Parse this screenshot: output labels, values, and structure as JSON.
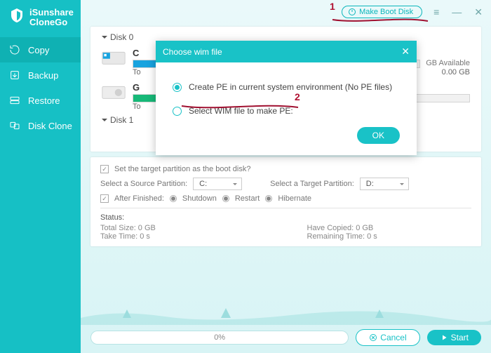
{
  "app": {
    "brand_line1": "iSunshare",
    "brand_line2": "CloneGo"
  },
  "sidebar": {
    "items": [
      {
        "label": "Copy"
      },
      {
        "label": "Backup"
      },
      {
        "label": "Restore"
      },
      {
        "label": "Disk Clone"
      }
    ]
  },
  "topbar": {
    "boot_label": "Make Boot Disk"
  },
  "disks": {
    "d0_head": "Disk 0",
    "d1_head": "Disk 1",
    "c_title": "C",
    "c_avail": "GB Available",
    "c_total_line": "To",
    "c_total_right": "0.00 GB",
    "g_title": "G",
    "g_total_line": "To"
  },
  "lower": {
    "set_target": "Set the target partition as the boot disk?",
    "src_label": "Select a Source Partition:",
    "src_val": "C:",
    "tgt_label": "Select a Target Partition:",
    "tgt_val": "D:",
    "after_label": "After Finished:",
    "r1": "Shutdown",
    "r2": "Restart",
    "r3": "Hibernate",
    "status_label": "Status:",
    "total_size": "Total Size: 0 GB",
    "have_copied": "Have Copied: 0 GB",
    "take_time": "Take Time: 0 s",
    "remaining": "Remaining Time: 0 s"
  },
  "bottom": {
    "progress": "0%",
    "cancel": "Cancel",
    "start": "Start"
  },
  "modal": {
    "title": "Choose wim file",
    "opt1": "Create PE in current system environment (No PE files)",
    "opt2": "Select WIM file to make PE:",
    "ok": "OK"
  },
  "annotations": {
    "n1": "1",
    "n2": "2"
  }
}
